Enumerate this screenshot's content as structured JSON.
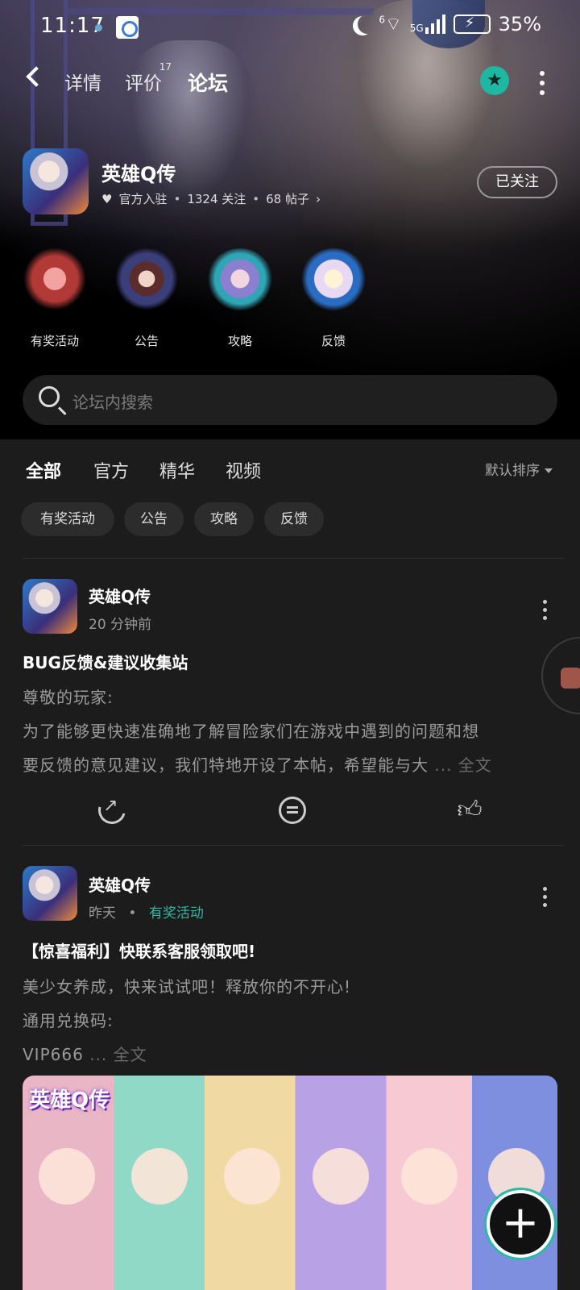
{
  "status_bar": {
    "time": "11:17",
    "network_6": "6",
    "network_5g": "5G",
    "battery": "35%"
  },
  "nav": {
    "tabs": [
      {
        "label": "详情"
      },
      {
        "label": "评价",
        "badge": "17"
      },
      {
        "label": "论坛"
      }
    ],
    "active_tab": "论坛"
  },
  "game": {
    "name": "英雄Q传",
    "official": "官方入驻",
    "follows": "1324 关注",
    "posts": "68 帖子",
    "follow_button": "已关注"
  },
  "categories": [
    {
      "label": "有奖活动"
    },
    {
      "label": "公告"
    },
    {
      "label": "攻略"
    },
    {
      "label": "反馈"
    }
  ],
  "search": {
    "placeholder": "论坛内搜索"
  },
  "filter_tabs": [
    {
      "label": "全部"
    },
    {
      "label": "官方"
    },
    {
      "label": "精华"
    },
    {
      "label": "视频"
    }
  ],
  "sort": {
    "label": "默认排序"
  },
  "chips": [
    {
      "label": "有奖活动"
    },
    {
      "label": "公告"
    },
    {
      "label": "攻略"
    },
    {
      "label": "反馈"
    }
  ],
  "posts": [
    {
      "author": "英雄Q传",
      "time": "20 分钟前",
      "title": "BUG反馈&建议收集站",
      "lines": [
        "尊敬的玩家:",
        "为了能够更快速准确地了解冒险家们在游戏中遇到的问题和想",
        "要反馈的意见建议，我们特地开设了本帖，希望能与大"
      ],
      "more": "... 全文"
    },
    {
      "author": "英雄Q传",
      "time": "昨天",
      "tag": "有奖活动",
      "title": "【惊喜福利】快联系客服领取吧!",
      "lines": [
        "美少女养成，快来试试吧！释放你的不开心!",
        "通用兑换码:",
        "VIP666"
      ],
      "more": "... 全文"
    }
  ],
  "banner": {
    "logo": "英雄Q传"
  },
  "fab": {
    "label": "+"
  },
  "colors": {
    "accent": "#2bb9a3",
    "background": "#1c1c1c"
  }
}
